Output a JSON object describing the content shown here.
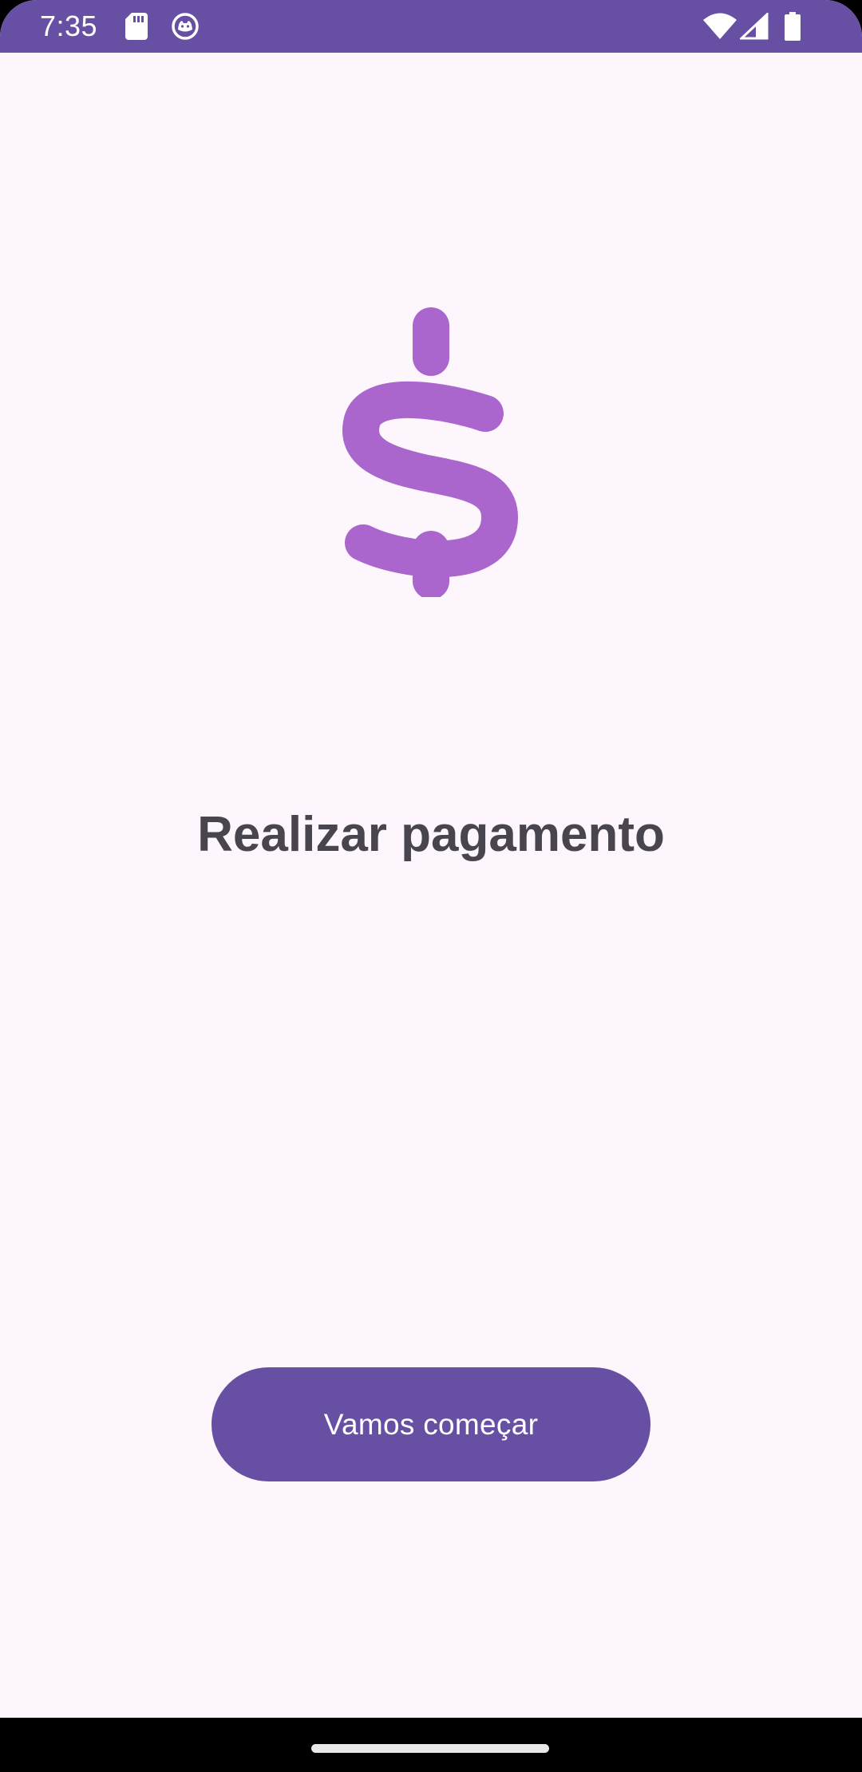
{
  "status_bar": {
    "time": "7:35",
    "icons": [
      "sd-card-icon",
      "cat-face-icon",
      "wifi-icon",
      "signal-icon",
      "battery-icon"
    ],
    "background_color": "#674FA3"
  },
  "main": {
    "hero_icon": "dollar-icon",
    "hero_icon_color": "#AA66CC",
    "title": "Realizar pagamento",
    "start_button_label": "Vamos começar",
    "accent_color": "#6750A4",
    "background_color": "#FDF7FD"
  },
  "nav_bar": {
    "handle": "gesture-handle"
  }
}
